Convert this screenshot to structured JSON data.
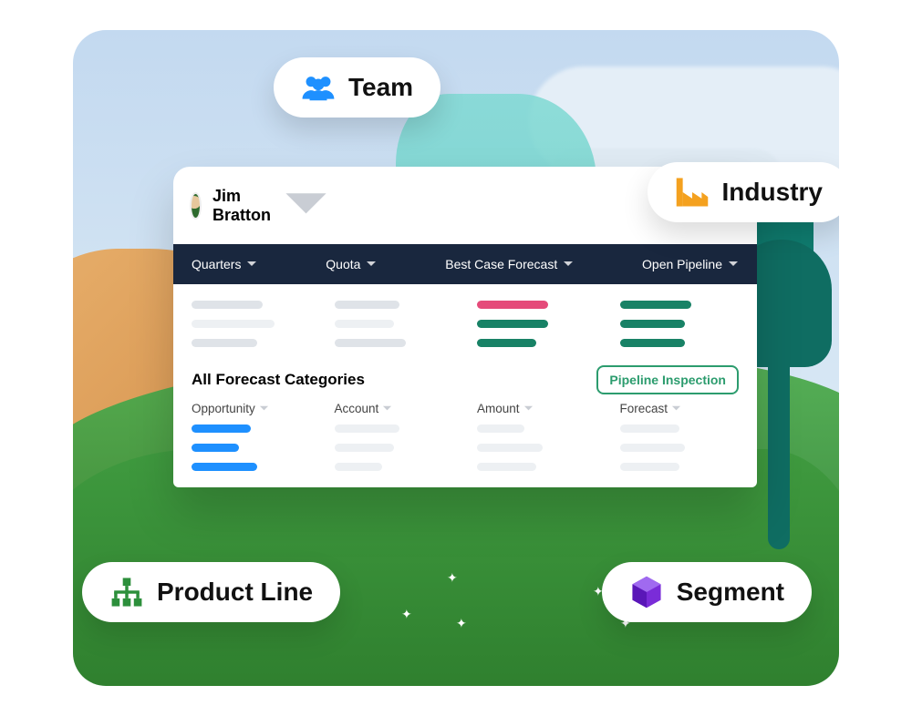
{
  "chips": {
    "team": {
      "label": "Team",
      "icon": "team-icon",
      "color": "#1e90ff"
    },
    "industry": {
      "label": "Industry",
      "icon": "factory-icon",
      "color": "#f4a11f"
    },
    "product": {
      "label": "Product Line",
      "icon": "hierarchy-icon",
      "color": "#2c8f3b"
    },
    "segment": {
      "label": "Segment",
      "icon": "cube-icon",
      "color": "#7a2cd8"
    }
  },
  "card": {
    "user_name": "Jim Bratton",
    "tabs": {
      "quarters": "Quarters",
      "quota": "Quota",
      "bestcase": "Best Case Forecast",
      "pipeline": "Open Pipeline"
    },
    "section_title": "All Forecast Categories",
    "pipeline_button": "Pipeline Inspection",
    "columns": {
      "opportunity": "Opportunity",
      "account": "Account",
      "amount": "Amount",
      "forecast": "Forecast"
    }
  }
}
